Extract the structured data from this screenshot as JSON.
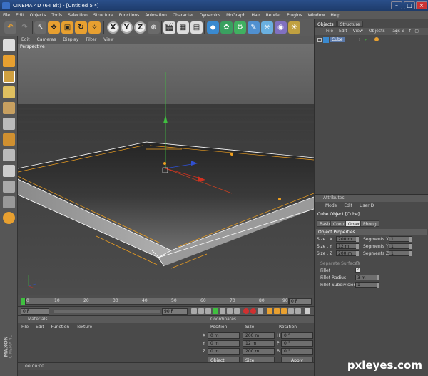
{
  "window": {
    "title": "CINEMA 4D (64 Bit) - [Untitled 5 *]",
    "controls": [
      "–",
      "□",
      "×"
    ]
  },
  "menubar": [
    "File",
    "Edit",
    "Objects",
    "Tools",
    "Selection",
    "Structure",
    "Functions",
    "Animation",
    "Character",
    "Dynamics",
    "MoGraph",
    "Hair",
    "Render",
    "Plugins",
    "Window",
    "Help"
  ],
  "toolbar": {
    "axis_x": "X",
    "axis_y": "Y",
    "axis_z": "Z"
  },
  "viewport": {
    "menu": [
      "Edit",
      "Cameras",
      "Display",
      "Filter",
      "View"
    ],
    "label": "Perspective"
  },
  "timeline": {
    "ticks": [
      "0",
      "10",
      "20",
      "30",
      "40",
      "50",
      "60",
      "70",
      "80",
      "90"
    ],
    "end_frame": "0 F",
    "current": "0 F",
    "range_end": "90 F"
  },
  "materials": {
    "title": "Materials",
    "menu": [
      "File",
      "Edit",
      "Function",
      "Texture"
    ]
  },
  "coordinates": {
    "title": "Coordinates",
    "headers": [
      "Position",
      "Size",
      "Rotation"
    ],
    "rows": [
      {
        "axis": "X",
        "pos": "0 m",
        "size": "200 m",
        "rot_axis": "H",
        "rot": "0 °"
      },
      {
        "axis": "Y",
        "pos": "0 m",
        "size": "12 m",
        "rot_axis": "P",
        "rot": "0 °"
      },
      {
        "axis": "Z",
        "pos": "0 m",
        "size": "200 m",
        "rot_axis": "B",
        "rot": "0 °"
      }
    ],
    "mode_object": "Object",
    "mode_size": "Size",
    "apply": "Apply"
  },
  "status": {
    "time": "00:00:00"
  },
  "objects": {
    "tabs": [
      "Objects",
      "Structure"
    ],
    "menu": [
      "File",
      "Edit",
      "View",
      "Objects",
      "Tags"
    ],
    "items": [
      {
        "name": "Cube"
      }
    ]
  },
  "attributes": {
    "title": "Attributes",
    "menu": [
      "Mode",
      "Edit",
      "User D"
    ],
    "object_title": "Cube Object [Cube]",
    "tabs": [
      "Basic",
      "Coord.",
      "Object",
      "Phong"
    ],
    "section": "Object Properties",
    "size_x": "200 m",
    "size_y": "12 m",
    "size_z": "200 m",
    "seg_x": "1",
    "seg_y": "1",
    "seg_z": "1",
    "separate_surfaces": "Separate Surfaces",
    "fillet": "Fillet",
    "fillet_radius": "Fillet Radius",
    "fillet_radius_value": "3 m",
    "fillet_subdiv": "Fillet Subdivision",
    "fillet_subdiv_value": "1",
    "labels": {
      "size_x": "Size . X",
      "size_y": "Size . Y",
      "size_z": "Size . Z",
      "seg_x": "Segments X",
      "seg_y": "Segments Y",
      "seg_z": "Segments Z"
    }
  },
  "brand": {
    "maxon": "MAXON",
    "c4d": "CINEMA 4D"
  },
  "watermark": "pxleyes.com",
  "colors": {
    "bg": "#4a4a4a",
    "accent": "#f0a020",
    "selection": "#ffffff"
  }
}
